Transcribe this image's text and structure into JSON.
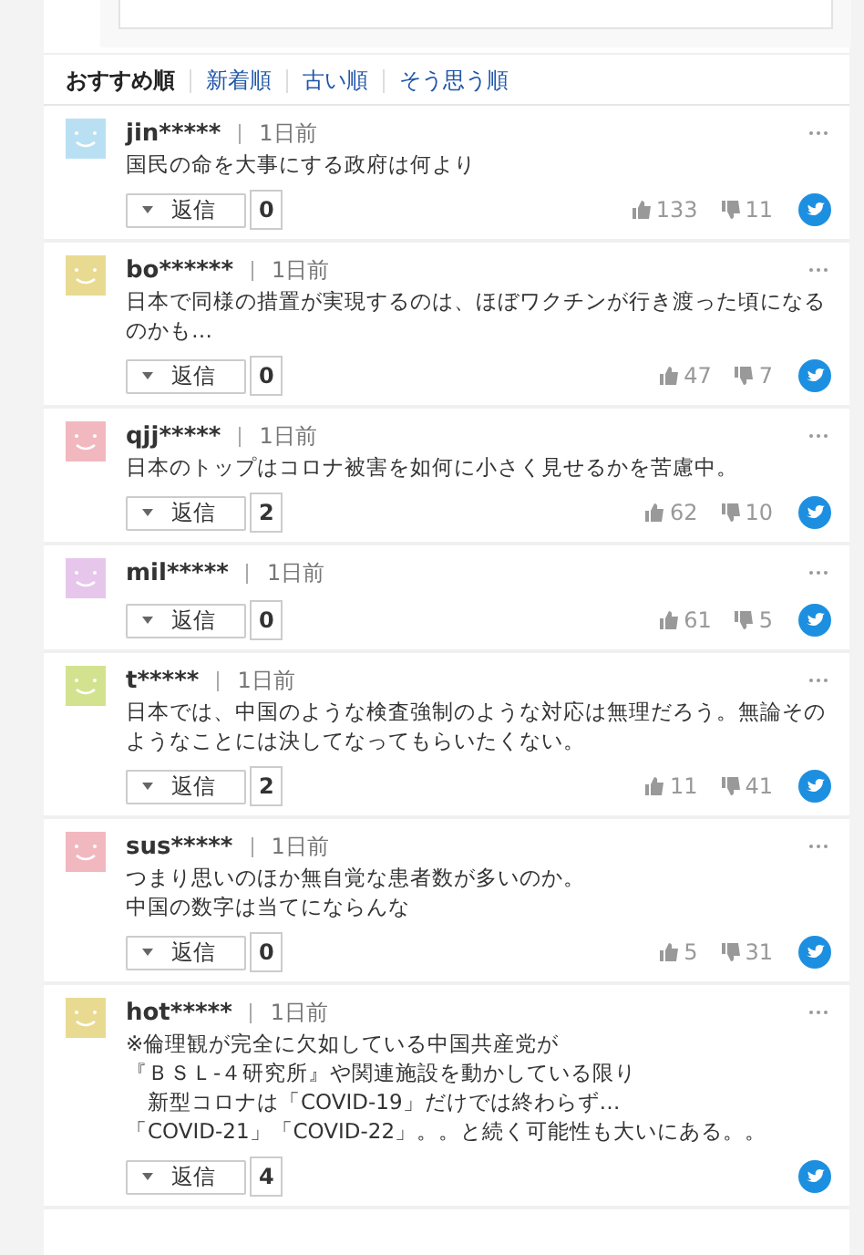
{
  "sort_tabs": [
    {
      "label": "おすすめ順",
      "selected": true
    },
    {
      "label": "新着順",
      "selected": false
    },
    {
      "label": "古い順",
      "selected": false
    },
    {
      "label": "そう思う順",
      "selected": false
    }
  ],
  "comments": [
    {
      "user": "jin*****",
      "time": "1日前",
      "color": "#b9e0f2",
      "lines": [
        "国民の命を大事にする政府は何より"
      ],
      "reply": "返信",
      "replies": "0",
      "likes": "133",
      "dislikes": "11"
    },
    {
      "user": "bo******",
      "time": "1日前",
      "color": "#e9da92",
      "lines": [
        "日本で同様の措置が実現するのは、ほぼワクチンが行き渡った頃になるのかも…"
      ],
      "reply": "返信",
      "replies": "0",
      "likes": "47",
      "dislikes": "7"
    },
    {
      "user": "qjj*****",
      "time": "1日前",
      "color": "#f2b8bf",
      "lines": [
        "日本のトップはコロナ被害を如何に小さく見せるかを苦慮中。"
      ],
      "reply": "返信",
      "replies": "2",
      "likes": "62",
      "dislikes": "10"
    },
    {
      "user": "mil*****",
      "time": "1日前",
      "color": "#e6c6ea",
      "reply": "返信",
      "replies": "0",
      "likes": "61",
      "dislikes": "5"
    },
    {
      "user": "t*****",
      "time": "1日前",
      "color": "#d2e28e",
      "lines": [
        "日本では、中国のような検査強制のような対応は無理だろう。無論そのようなことには決してなってもらいたくない。"
      ],
      "reply": "返信",
      "replies": "2",
      "likes": "11",
      "dislikes": "41"
    },
    {
      "user": "sus*****",
      "time": "1日前",
      "color": "#f2b8bf",
      "lines": [
        "つまり思いのほか無自覚な患者数が多いのか。",
        "中国の数字は当てにならんな"
      ],
      "reply": "返信",
      "replies": "0",
      "likes": "5",
      "dislikes": "31"
    },
    {
      "user": "hot*****",
      "time": "1日前",
      "color": "#e9da92",
      "lines": [
        "※倫理観が完全に欠如している中国共産党が",
        "『ＢＳＬ-４研究所』や関連施設を動かしている限り",
        "　新型コロナは「COVID-19」だけでは終わらず…",
        "「COVID-21」「COVID-22」。。と続く可能性も大いにある。。"
      ],
      "reply": "返信",
      "replies": "4"
    }
  ]
}
